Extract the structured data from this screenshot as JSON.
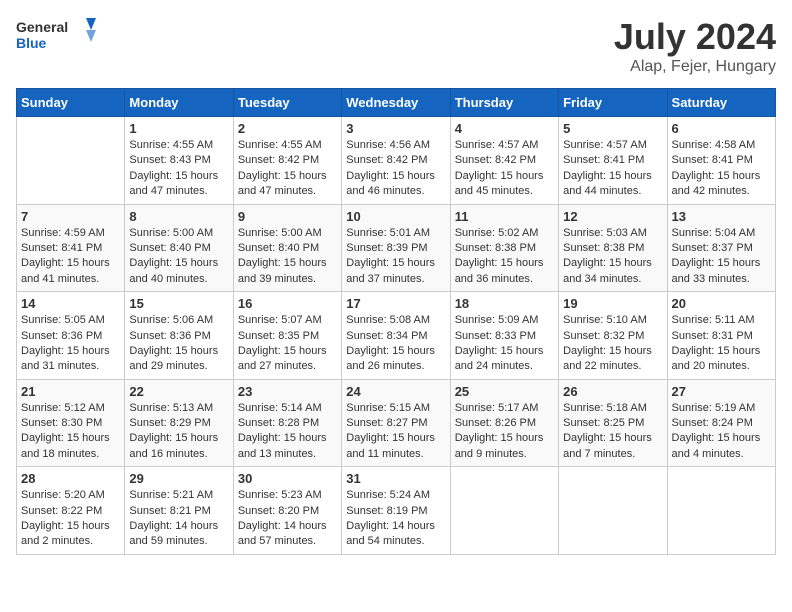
{
  "header": {
    "logo_general": "General",
    "logo_blue": "Blue",
    "month_year": "July 2024",
    "location": "Alap, Fejer, Hungary"
  },
  "calendar": {
    "days_of_week": [
      "Sunday",
      "Monday",
      "Tuesday",
      "Wednesday",
      "Thursday",
      "Friday",
      "Saturday"
    ],
    "weeks": [
      [
        {
          "day": "",
          "info": ""
        },
        {
          "day": "1",
          "info": "Sunrise: 4:55 AM\nSunset: 8:43 PM\nDaylight: 15 hours\nand 47 minutes."
        },
        {
          "day": "2",
          "info": "Sunrise: 4:55 AM\nSunset: 8:42 PM\nDaylight: 15 hours\nand 47 minutes."
        },
        {
          "day": "3",
          "info": "Sunrise: 4:56 AM\nSunset: 8:42 PM\nDaylight: 15 hours\nand 46 minutes."
        },
        {
          "day": "4",
          "info": "Sunrise: 4:57 AM\nSunset: 8:42 PM\nDaylight: 15 hours\nand 45 minutes."
        },
        {
          "day": "5",
          "info": "Sunrise: 4:57 AM\nSunset: 8:41 PM\nDaylight: 15 hours\nand 44 minutes."
        },
        {
          "day": "6",
          "info": "Sunrise: 4:58 AM\nSunset: 8:41 PM\nDaylight: 15 hours\nand 42 minutes."
        }
      ],
      [
        {
          "day": "7",
          "info": "Sunrise: 4:59 AM\nSunset: 8:41 PM\nDaylight: 15 hours\nand 41 minutes."
        },
        {
          "day": "8",
          "info": "Sunrise: 5:00 AM\nSunset: 8:40 PM\nDaylight: 15 hours\nand 40 minutes."
        },
        {
          "day": "9",
          "info": "Sunrise: 5:00 AM\nSunset: 8:40 PM\nDaylight: 15 hours\nand 39 minutes."
        },
        {
          "day": "10",
          "info": "Sunrise: 5:01 AM\nSunset: 8:39 PM\nDaylight: 15 hours\nand 37 minutes."
        },
        {
          "day": "11",
          "info": "Sunrise: 5:02 AM\nSunset: 8:38 PM\nDaylight: 15 hours\nand 36 minutes."
        },
        {
          "day": "12",
          "info": "Sunrise: 5:03 AM\nSunset: 8:38 PM\nDaylight: 15 hours\nand 34 minutes."
        },
        {
          "day": "13",
          "info": "Sunrise: 5:04 AM\nSunset: 8:37 PM\nDaylight: 15 hours\nand 33 minutes."
        }
      ],
      [
        {
          "day": "14",
          "info": "Sunrise: 5:05 AM\nSunset: 8:36 PM\nDaylight: 15 hours\nand 31 minutes."
        },
        {
          "day": "15",
          "info": "Sunrise: 5:06 AM\nSunset: 8:36 PM\nDaylight: 15 hours\nand 29 minutes."
        },
        {
          "day": "16",
          "info": "Sunrise: 5:07 AM\nSunset: 8:35 PM\nDaylight: 15 hours\nand 27 minutes."
        },
        {
          "day": "17",
          "info": "Sunrise: 5:08 AM\nSunset: 8:34 PM\nDaylight: 15 hours\nand 26 minutes."
        },
        {
          "day": "18",
          "info": "Sunrise: 5:09 AM\nSunset: 8:33 PM\nDaylight: 15 hours\nand 24 minutes."
        },
        {
          "day": "19",
          "info": "Sunrise: 5:10 AM\nSunset: 8:32 PM\nDaylight: 15 hours\nand 22 minutes."
        },
        {
          "day": "20",
          "info": "Sunrise: 5:11 AM\nSunset: 8:31 PM\nDaylight: 15 hours\nand 20 minutes."
        }
      ],
      [
        {
          "day": "21",
          "info": "Sunrise: 5:12 AM\nSunset: 8:30 PM\nDaylight: 15 hours\nand 18 minutes."
        },
        {
          "day": "22",
          "info": "Sunrise: 5:13 AM\nSunset: 8:29 PM\nDaylight: 15 hours\nand 16 minutes."
        },
        {
          "day": "23",
          "info": "Sunrise: 5:14 AM\nSunset: 8:28 PM\nDaylight: 15 hours\nand 13 minutes."
        },
        {
          "day": "24",
          "info": "Sunrise: 5:15 AM\nSunset: 8:27 PM\nDaylight: 15 hours\nand 11 minutes."
        },
        {
          "day": "25",
          "info": "Sunrise: 5:17 AM\nSunset: 8:26 PM\nDaylight: 15 hours\nand 9 minutes."
        },
        {
          "day": "26",
          "info": "Sunrise: 5:18 AM\nSunset: 8:25 PM\nDaylight: 15 hours\nand 7 minutes."
        },
        {
          "day": "27",
          "info": "Sunrise: 5:19 AM\nSunset: 8:24 PM\nDaylight: 15 hours\nand 4 minutes."
        }
      ],
      [
        {
          "day": "28",
          "info": "Sunrise: 5:20 AM\nSunset: 8:22 PM\nDaylight: 15 hours\nand 2 minutes."
        },
        {
          "day": "29",
          "info": "Sunrise: 5:21 AM\nSunset: 8:21 PM\nDaylight: 14 hours\nand 59 minutes."
        },
        {
          "day": "30",
          "info": "Sunrise: 5:23 AM\nSunset: 8:20 PM\nDaylight: 14 hours\nand 57 minutes."
        },
        {
          "day": "31",
          "info": "Sunrise: 5:24 AM\nSunset: 8:19 PM\nDaylight: 14 hours\nand 54 minutes."
        },
        {
          "day": "",
          "info": ""
        },
        {
          "day": "",
          "info": ""
        },
        {
          "day": "",
          "info": ""
        }
      ]
    ]
  }
}
